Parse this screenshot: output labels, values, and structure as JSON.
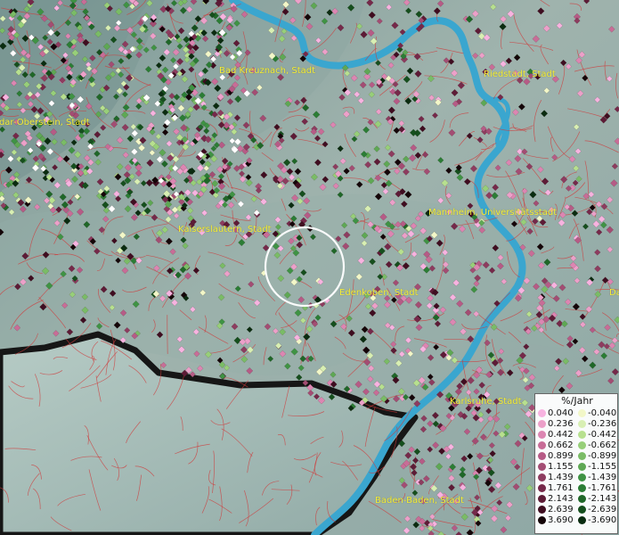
{
  "map": {
    "cities": [
      {
        "name": "Bad Kreuznach, Stadt"
      },
      {
        "name": "Riedstadt, Stadt"
      },
      {
        "name": "Idar-Oberstein, Stadt"
      },
      {
        "name": "Kaiserslautern, Stadt"
      },
      {
        "name": "Mannheim, Universitätsstadt"
      },
      {
        "name": "Edenkoben, Stadt"
      },
      {
        "name": "Karlsruhe, Stadt"
      },
      {
        "name": "Baden-Baden, Stadt"
      },
      {
        "name": "Da"
      }
    ],
    "colors": {
      "pink_scale": [
        "#f7b3e0",
        "#eca0c9",
        "#dc86b2",
        "#c86d97",
        "#b65b86",
        "#a34d73",
        "#8d3c5f",
        "#75294a",
        "#5d1b36",
        "#3f0d20",
        "#140508"
      ],
      "green_scale": [
        "#f2f7c8",
        "#d8efb3",
        "#b7e08f",
        "#97cf79",
        "#7abc66",
        "#5ea854",
        "#3f9344",
        "#2b7d35",
        "#1f6728",
        "#154f1d",
        "#0a2c10"
      ],
      "river": "#3aa6cf",
      "boundary": "#cf3b3b",
      "terrain": "#95aca9",
      "dark_border": "#1b1b1b"
    }
  },
  "legend": {
    "title": "%/Jahr",
    "positive": [
      "0.040",
      "0.236",
      "0.442",
      "0.662",
      "0.899",
      "1.155",
      "1.439",
      "1.761",
      "2.143",
      "2.639",
      "3.690"
    ],
    "negative": [
      "-0.040",
      "-0.236",
      "-0.442",
      "-0.662",
      "-0.899",
      "-1.155",
      "-1.439",
      "-1.761",
      "-2.143",
      "-2.639",
      "-3.690"
    ]
  }
}
